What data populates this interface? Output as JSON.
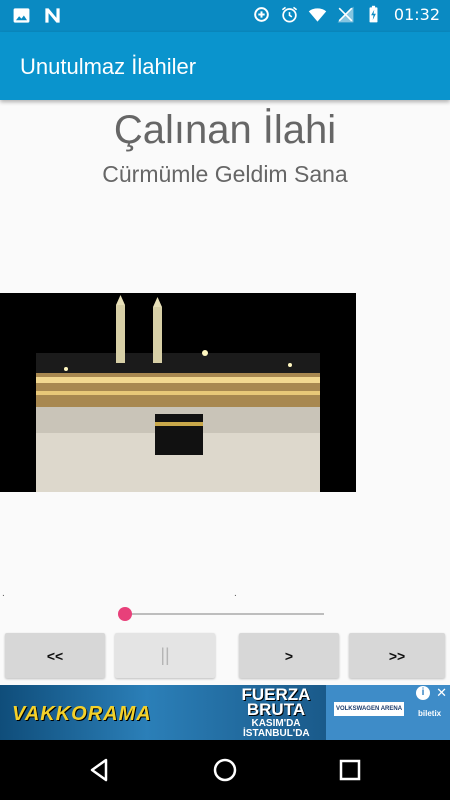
{
  "status_bar": {
    "time": "01:32",
    "left_icons": [
      "image-icon",
      "n-icon"
    ],
    "right_icons": [
      "data-saver-icon",
      "alarm-icon",
      "wifi-icon",
      "signal-icon",
      "battery-icon"
    ]
  },
  "app_bar": {
    "title": "Unutulmaz İlahiler",
    "color": "#0a94cd"
  },
  "player": {
    "now_playing_label": "Çalınan İlahi",
    "song_title": "Cürmümle Geldim Sana",
    "time_elapsed": ".",
    "time_total": ".",
    "progress": 0,
    "accent_color": "#e8407a"
  },
  "controls": {
    "rewind_label": "<<",
    "pause_label": "||",
    "play_label": ">",
    "forward_label": ">>"
  },
  "ad": {
    "brand": "VAKKORAMA",
    "headline": "FUERZA BRUTA",
    "subline": "KASIM'DA İSTANBUL'DA",
    "venue": "VOLKSWAGEN ARENA",
    "ticketing": "biletix",
    "info_icon": "i",
    "close_icon": "✕"
  },
  "nav_bar": {
    "icons": [
      "back-icon",
      "home-icon",
      "recents-icon"
    ]
  }
}
